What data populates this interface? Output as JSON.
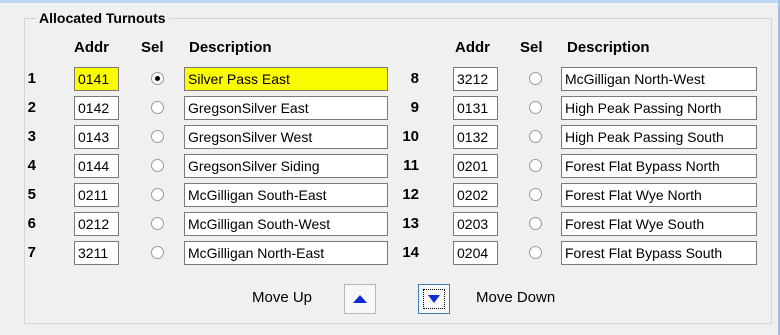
{
  "group_title": "Allocated Turnouts",
  "headers": {
    "addr": "Addr",
    "sel": "Sel",
    "description": "Description"
  },
  "highlight_color": "#fcfc00",
  "left_rows": [
    {
      "num": "1",
      "addr": "0141",
      "description": "Silver Pass East",
      "selected": true
    },
    {
      "num": "2",
      "addr": "0142",
      "description": "GregsonSilver East",
      "selected": false
    },
    {
      "num": "3",
      "addr": "0143",
      "description": "GregsonSilver West",
      "selected": false
    },
    {
      "num": "4",
      "addr": "0144",
      "description": "GregsonSilver Siding",
      "selected": false
    },
    {
      "num": "5",
      "addr": "0211",
      "description": "McGilligan South-East",
      "selected": false
    },
    {
      "num": "6",
      "addr": "0212",
      "description": "McGilligan South-West",
      "selected": false
    },
    {
      "num": "7",
      "addr": "3211",
      "description": "McGilligan North-East",
      "selected": false
    }
  ],
  "right_rows": [
    {
      "num": "8",
      "addr": "3212",
      "description": "McGilligan North-West",
      "selected": false
    },
    {
      "num": "9",
      "addr": "0131",
      "description": "High Peak Passing North",
      "selected": false
    },
    {
      "num": "10",
      "addr": "0132",
      "description": "High Peak Passing South",
      "selected": false
    },
    {
      "num": "11",
      "addr": "0201",
      "description": "Forest Flat Bypass North",
      "selected": false
    },
    {
      "num": "12",
      "addr": "0202",
      "description": "Forest Flat Wye North",
      "selected": false
    },
    {
      "num": "13",
      "addr": "0203",
      "description": "Forest Flat Wye South",
      "selected": false
    },
    {
      "num": "14",
      "addr": "0204",
      "description": "Forest Flat Bypass South",
      "selected": false
    }
  ],
  "move_up_label": "Move Up",
  "move_down_label": "Move Down",
  "move_up_icon": "arrow-up-icon",
  "move_down_icon": "arrow-down-icon"
}
